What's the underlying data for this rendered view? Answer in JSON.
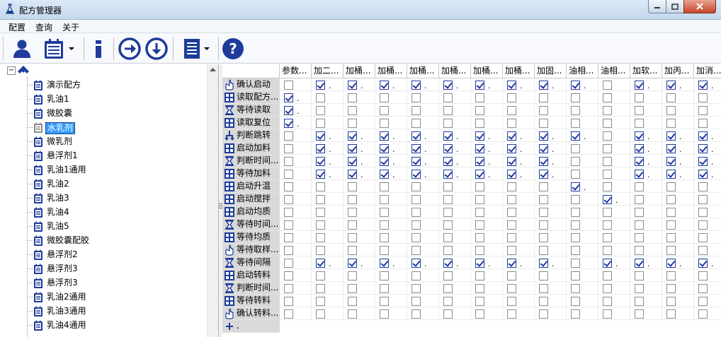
{
  "window": {
    "title": "配方管理器"
  },
  "menu": [
    "配置",
    "查询",
    "关于"
  ],
  "toolbar": {
    "buttons": [
      {
        "name": "user-icon"
      },
      {
        "name": "recipe-list-icon",
        "dropdown": true
      },
      {
        "name": "info-icon"
      },
      {
        "name": "arrow-right-circle-icon"
      },
      {
        "name": "arrow-down-circle-icon"
      },
      {
        "name": "document-list-icon",
        "dropdown": true
      },
      {
        "name": "help-icon"
      }
    ]
  },
  "tree": {
    "root_toggle": "⊟",
    "items": [
      "演示配方",
      "乳油1",
      "微胶囊",
      "水乳剂",
      "微乳剂",
      "悬浮剂1",
      "乳油1通用",
      "乳油2",
      "乳油3",
      "乳油4",
      "乳油5",
      "微胶囊配胶",
      "悬浮剂2",
      "悬浮剂3",
      "悬浮剂3",
      "乳油2通用",
      "乳油3通用",
      "乳油4通用"
    ],
    "selected": 3,
    "selected_icon_gray": true
  },
  "grid": {
    "columns": [
      "参数...",
      "加二...",
      "加桶...",
      "加桶...",
      "加桶...",
      "加桶...",
      "加桶...",
      "加桶...",
      "加固...",
      "油相...",
      "油相...",
      "加软...",
      "加丙...",
      "加消..."
    ],
    "add_row_label": "+",
    "add_row_suffix": ".",
    "rows": [
      {
        "label": "确认启动",
        "icon": "hand-icon",
        "checks": [
          0,
          1,
          1,
          1,
          1,
          1,
          1,
          1,
          1,
          1,
          0,
          1,
          1,
          1
        ]
      },
      {
        "label": "读取配方...",
        "icon": "grid-icon",
        "checks": [
          1,
          0,
          0,
          0,
          0,
          0,
          0,
          0,
          0,
          0,
          0,
          0,
          0,
          0
        ]
      },
      {
        "label": "等待读取",
        "icon": "hourglass-icon",
        "checks": [
          1,
          0,
          0,
          0,
          0,
          0,
          0,
          0,
          0,
          0,
          0,
          0,
          0,
          0
        ]
      },
      {
        "label": "读取复位",
        "icon": "grid-icon",
        "checks": [
          1,
          0,
          0,
          0,
          0,
          0,
          0,
          0,
          0,
          0,
          0,
          0,
          0,
          0
        ]
      },
      {
        "label": "判断跳转",
        "icon": "branch-icon",
        "checks": [
          0,
          1,
          1,
          1,
          1,
          1,
          1,
          1,
          1,
          1,
          0,
          1,
          1,
          1
        ]
      },
      {
        "label": "启动加料",
        "icon": "grid-icon",
        "checks": [
          0,
          1,
          1,
          1,
          1,
          1,
          1,
          1,
          1,
          0,
          0,
          1,
          1,
          1
        ]
      },
      {
        "label": "判断时间...",
        "icon": "hourglass-icon",
        "checks": [
          0,
          1,
          1,
          1,
          1,
          1,
          1,
          1,
          1,
          0,
          0,
          1,
          1,
          1
        ]
      },
      {
        "label": "等待加料",
        "icon": "grid-icon",
        "checks": [
          0,
          1,
          1,
          1,
          1,
          1,
          1,
          1,
          1,
          0,
          0,
          1,
          1,
          1
        ]
      },
      {
        "label": "启动升温",
        "icon": "grid-icon",
        "checks": [
          0,
          0,
          0,
          0,
          0,
          0,
          0,
          0,
          0,
          1,
          0,
          0,
          0,
          0
        ]
      },
      {
        "label": "启动搅拌",
        "icon": "grid-icon",
        "checks": [
          0,
          0,
          0,
          0,
          0,
          0,
          0,
          0,
          0,
          0,
          1,
          0,
          0,
          0
        ]
      },
      {
        "label": "启动均质",
        "icon": "grid-icon",
        "checks": [
          0,
          0,
          0,
          0,
          0,
          0,
          0,
          0,
          0,
          0,
          0,
          0,
          0,
          0
        ]
      },
      {
        "label": "等待时间...",
        "icon": "hourglass-icon",
        "checks": [
          0,
          0,
          0,
          0,
          0,
          0,
          0,
          0,
          0,
          0,
          0,
          0,
          0,
          0
        ]
      },
      {
        "label": "等待均质",
        "icon": "grid-icon",
        "checks": [
          0,
          0,
          0,
          0,
          0,
          0,
          0,
          0,
          0,
          0,
          0,
          0,
          0,
          0
        ]
      },
      {
        "label": "等待取样...",
        "icon": "hand-icon",
        "checks": [
          0,
          0,
          0,
          0,
          0,
          0,
          0,
          0,
          0,
          0,
          0,
          0,
          0,
          0
        ]
      },
      {
        "label": "等待间隔",
        "icon": "hourglass-icon",
        "checks": [
          0,
          1,
          1,
          1,
          1,
          1,
          1,
          1,
          1,
          0,
          1,
          1,
          1,
          1
        ]
      },
      {
        "label": "启动转料",
        "icon": "grid-icon",
        "checks": [
          0,
          0,
          0,
          0,
          0,
          0,
          0,
          0,
          0,
          0,
          0,
          0,
          0,
          0
        ]
      },
      {
        "label": "判断时间...",
        "icon": "hourglass-icon",
        "checks": [
          0,
          0,
          0,
          0,
          0,
          0,
          0,
          0,
          0,
          0,
          0,
          0,
          0,
          0
        ]
      },
      {
        "label": "等待转料",
        "icon": "grid-icon",
        "checks": [
          0,
          0,
          0,
          0,
          0,
          0,
          0,
          0,
          0,
          0,
          0,
          0,
          0,
          0
        ]
      },
      {
        "label": "确认转料...",
        "icon": "hand-icon",
        "checks": [
          0,
          0,
          0,
          0,
          0,
          0,
          0,
          0,
          0,
          0,
          0,
          0,
          0,
          0
        ]
      }
    ],
    "check_suffix": "."
  },
  "colors": {
    "accent": "#1f3b9b",
    "selection": "#3399ff",
    "rowheader": "#d9d9d9"
  }
}
